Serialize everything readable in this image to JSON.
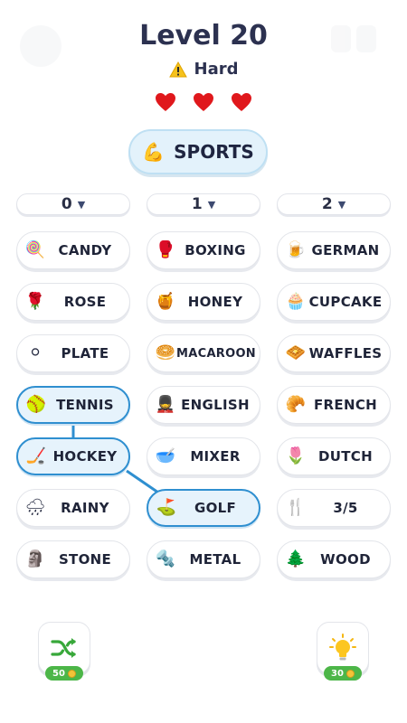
{
  "header": {
    "title": "Level 20",
    "difficulty": "Hard",
    "lives": 3
  },
  "category": {
    "emoji": "💪",
    "label": "SPORTS"
  },
  "counters": [
    "0",
    "1",
    "2"
  ],
  "tiles": [
    {
      "emoji": "🍭",
      "label": "CANDY",
      "selected": false
    },
    {
      "emoji": "🥊",
      "label": "BOXING",
      "selected": false
    },
    {
      "emoji": "🍺",
      "label": "GERMAN",
      "selected": false
    },
    {
      "emoji": "🌹",
      "label": "ROSE",
      "selected": false
    },
    {
      "emoji": "🍯",
      "label": "HONEY",
      "selected": false
    },
    {
      "emoji": "🧁",
      "label": "CUPCAKE",
      "selected": false
    },
    {
      "emoji": "⚪",
      "label": "PLATE",
      "selected": false
    },
    {
      "emoji": "🥯",
      "label": "MACAROON",
      "selected": false
    },
    {
      "emoji": "🧇",
      "label": "WAFFLES",
      "selected": false
    },
    {
      "emoji": "🥎",
      "label": "TENNIS",
      "selected": true
    },
    {
      "emoji": "💂",
      "label": "ENGLISH",
      "selected": false
    },
    {
      "emoji": "🥐",
      "label": "FRENCH",
      "selected": false
    },
    {
      "emoji": "🏒",
      "label": "HOCKEY",
      "selected": true
    },
    {
      "emoji": "🥣",
      "label": "MIXER",
      "selected": false
    },
    {
      "emoji": "🌷",
      "label": "DUTCH",
      "selected": false
    },
    {
      "emoji": "🌧",
      "label": "RAINY",
      "selected": false
    },
    {
      "emoji": "⛳",
      "label": "GOLF",
      "selected": true
    },
    {
      "emoji": "🍴",
      "label": "3/5",
      "selected": false
    },
    {
      "emoji": "🗿",
      "label": "STONE",
      "selected": false
    },
    {
      "emoji": "🔩",
      "label": "METAL",
      "selected": false
    },
    {
      "emoji": "🌲",
      "label": "WOOD",
      "selected": false
    }
  ],
  "powerups": {
    "shuffle": {
      "icon": "shuffle-icon",
      "cost": "50"
    },
    "hint": {
      "icon": "lightbulb-icon",
      "cost": "30"
    }
  },
  "colors": {
    "accent": "#2f8fd0",
    "selected_bg": "#e6f3fc",
    "heart": "#e0181c",
    "coin_badge": "#4cb648"
  }
}
